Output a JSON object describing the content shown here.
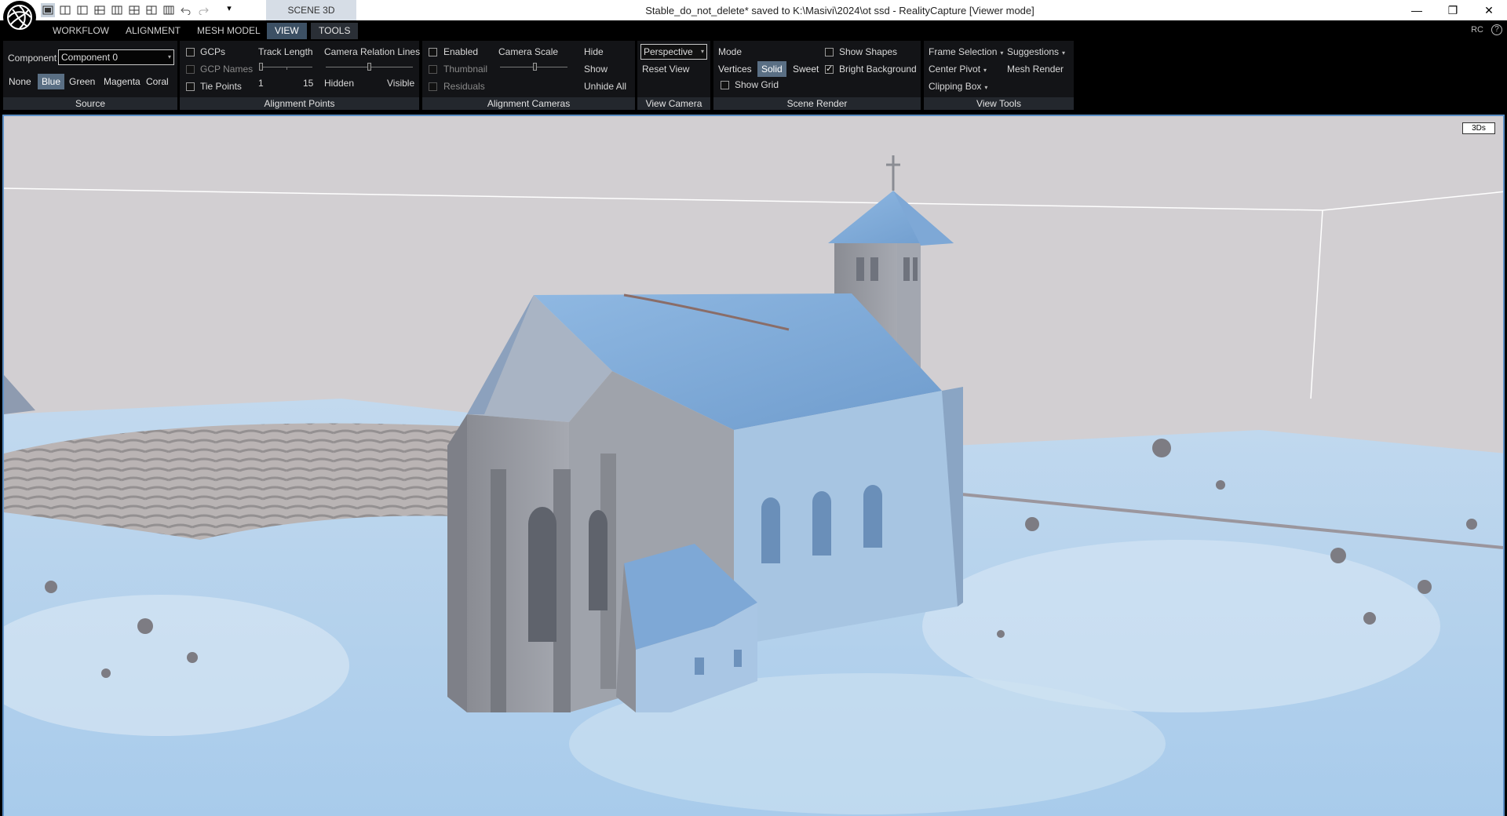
{
  "titlebar": {
    "scene_tab": "SCENE 3D",
    "window_title": "Stable_do_not_delete* saved to K:\\Masivi\\2024\\ot ssd - RealityCapture [Viewer mode]",
    "qat_icons": [
      "layout-1-icon",
      "layout-2-icon",
      "layout-3-icon",
      "layout-4-icon",
      "layout-5-icon",
      "layout-6-icon",
      "layout-7-icon",
      "layout-8-icon",
      "undo-icon",
      "redo-icon"
    ],
    "more_glyph": "▾",
    "controls": {
      "minimize": "—",
      "restore": "❐",
      "close": "✕"
    }
  },
  "menu": {
    "items": [
      "WORKFLOW",
      "ALIGNMENT",
      "MESH MODEL",
      "VIEW",
      "TOOLS"
    ],
    "active": "VIEW",
    "right_label": "RC",
    "help": "?"
  },
  "ribbon": {
    "source": {
      "label": "Source",
      "component_label": "Component",
      "component_value": "Component 0",
      "colors": [
        "None",
        "Blue",
        "Green",
        "Magenta",
        "Coral"
      ],
      "selected_color": "Blue"
    },
    "alignment_points": {
      "label": "Alignment Points",
      "gcps": "GCPs",
      "gcp_names": "GCP Names",
      "tie_points": "Tie Points",
      "track_length": "Track Length",
      "track_min": "1",
      "track_max": "15",
      "camera_relation_lines": "Camera Relation Lines",
      "hidden": "Hidden",
      "visible": "Visible"
    },
    "alignment_cameras": {
      "label": "Alignment Cameras",
      "enabled": "Enabled",
      "thumbnail": "Thumbnail",
      "residuals": "Residuals",
      "camera_scale": "Camera Scale",
      "hide": "Hide",
      "show": "Show",
      "unhide_all": "Unhide All"
    },
    "view_camera": {
      "label": "View Camera",
      "projection": "Perspective",
      "reset_view": "Reset View"
    },
    "scene_render": {
      "label": "Scene Render",
      "mode": "Mode",
      "modes": [
        "Vertices",
        "Solid",
        "Sweet"
      ],
      "selected_mode": "Solid",
      "show_grid": "Show Grid",
      "show_shapes": "Show Shapes",
      "bright_background": "Bright Background",
      "show_grid_checked": false,
      "show_shapes_checked": false,
      "bright_background_checked": true
    },
    "view_tools": {
      "label": "View Tools",
      "frame_selection": "Frame Selection",
      "suggestions": "Suggestions",
      "center_pivot": "Center Pivot",
      "mesh_render": "Mesh Render",
      "clipping_box": "Clipping Box"
    }
  },
  "viewport": {
    "mode_button": "3Ds",
    "colors": {
      "sky": "#d2cfd2",
      "mesh": "#9fc3e8",
      "border": "#5b8ec4"
    }
  }
}
